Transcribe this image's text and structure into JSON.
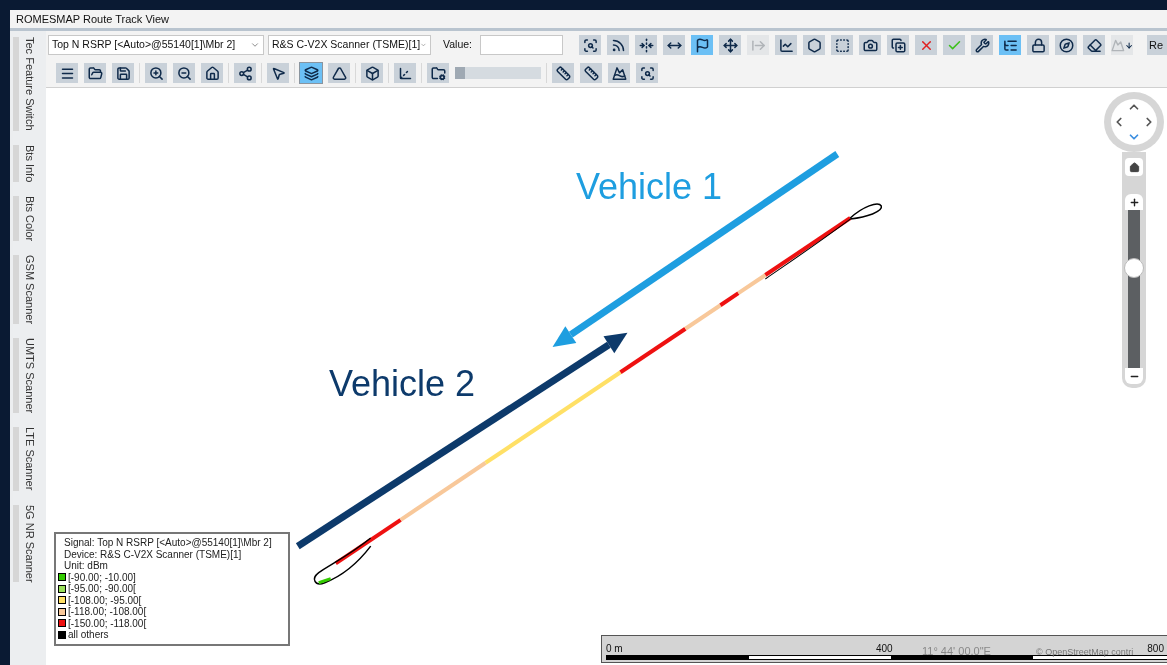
{
  "window": {
    "title": "ROMESMAP Route Track View"
  },
  "side_tabs": [
    {
      "label": "Tec Feature Switch",
      "selected": false
    },
    {
      "label": "Bts Info",
      "selected": false
    },
    {
      "label": "Bts Color",
      "selected": false
    },
    {
      "label": "GSM Scanner",
      "selected": false
    },
    {
      "label": "UMTS Scanner",
      "selected": false
    },
    {
      "label": "LTE Scanner",
      "selected": false
    },
    {
      "label": "5G NR Scanner",
      "selected": false
    }
  ],
  "toolbar": {
    "signal_select": {
      "value": "Top N RSRP [<Auto>@55140[1]\\Mbr 2]"
    },
    "device_select": {
      "value": "R&S C-V2X Scanner (TSME)[1]"
    },
    "value_label": "Value:",
    "row_1": [
      {
        "kind": "zoom-area",
        "selected": false,
        "disabled": false
      },
      {
        "kind": "rays",
        "selected": false,
        "disabled": false
      },
      {
        "kind": "shrink",
        "selected": false,
        "disabled": false
      },
      {
        "kind": "expand",
        "selected": false,
        "disabled": false
      },
      {
        "kind": "flag",
        "selected": true,
        "disabled": false
      },
      {
        "kind": "move",
        "selected": false,
        "disabled": false
      },
      {
        "kind": "export",
        "selected": false,
        "disabled": true
      },
      {
        "kind": "lines",
        "selected": false,
        "disabled": false
      },
      {
        "kind": "hexagons",
        "selected": false,
        "disabled": false
      },
      {
        "kind": "dashed-square",
        "selected": false,
        "disabled": false
      },
      {
        "kind": "camera",
        "selected": false,
        "disabled": false
      },
      {
        "kind": "add",
        "selected": false,
        "disabled": false
      },
      {
        "kind": "remove",
        "selected": false,
        "disabled": false
      },
      {
        "kind": "check",
        "selected": false,
        "disabled": false
      },
      {
        "kind": "wrench",
        "selected": false,
        "disabled": false
      },
      {
        "kind": "list-tree",
        "selected": true,
        "disabled": false
      },
      {
        "kind": "lock",
        "selected": false,
        "disabled": false
      },
      {
        "kind": "compass",
        "selected": false,
        "disabled": false
      },
      {
        "kind": "eraser",
        "selected": false,
        "disabled": false
      },
      {
        "kind": "mountain-down",
        "selected": false,
        "disabled": true
      }
    ],
    "cut_button": "Re",
    "row_2": [
      [
        {
          "kind": "menu",
          "selected": false
        },
        {
          "kind": "open",
          "selected": false
        },
        {
          "kind": "save",
          "selected": false
        }
      ],
      [
        {
          "kind": "zoom-in",
          "selected": false
        },
        {
          "kind": "zoom-out",
          "selected": false
        },
        {
          "kind": "home",
          "selected": false
        }
      ],
      [
        {
          "kind": "network",
          "selected": false
        }
      ],
      [
        {
          "kind": "pointer",
          "selected": false
        }
      ],
      [
        {
          "kind": "layers",
          "selected": true
        },
        {
          "kind": "triangle",
          "selected": false
        }
      ],
      [
        {
          "kind": "cube",
          "selected": false
        }
      ],
      [
        {
          "kind": "axis-3d",
          "selected": false
        }
      ],
      [
        {
          "kind": "folder-gear",
          "selected": false
        },
        {
          "kind": "slider",
          "level": 0
        }
      ],
      [
        {
          "kind": "ruler",
          "selected": false
        },
        {
          "kind": "ruler",
          "selected": false
        },
        {
          "kind": "mountains",
          "selected": false
        },
        {
          "kind": "zoom-area",
          "selected": false
        }
      ]
    ]
  },
  "map": {
    "labels": [
      {
        "text": "Vehicle 1",
        "color": "#1e9ee0"
      },
      {
        "text": "Vehicle 2",
        "color": "#0d3a6b"
      }
    ],
    "legend": {
      "signal": "Signal: Top N RSRP [<Auto>@55140[1]\\Mbr 2]",
      "device": "Device: R&S C-V2X Scanner (TSME)[1]",
      "unit": "Unit: dBm",
      "items": [
        {
          "label": "[-90.00; -10.00]",
          "color": "#33cc00"
        },
        {
          "label": "[-95.00; -90.00[",
          "color": "#99e05a"
        },
        {
          "label": "[-108.00; -95.00[",
          "color": "#ffe066"
        },
        {
          "label": "[-118.00; -108.00[",
          "color": "#f8c89a"
        },
        {
          "label": "[-150.00; -118.00[",
          "color": "#ee1111"
        },
        {
          "label": "all others",
          "color": "#000000"
        }
      ]
    },
    "scale_bar": {
      "start": "0 m",
      "mid": "400",
      "end": "800",
      "coordinate": "11° 44' 00.0\"E",
      "attribution": "© OpenStreetMap contri"
    },
    "zoom_control": {
      "level": 0.65
    }
  }
}
